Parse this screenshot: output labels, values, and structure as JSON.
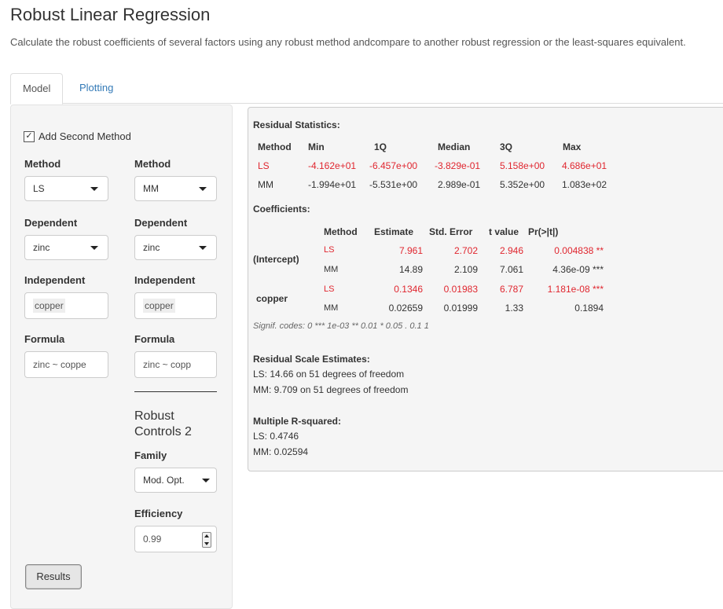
{
  "page": {
    "title": "Robust Linear Regression",
    "description": "Calculate the robust coefficients of several factors using any robust method andcompare to another robust regression or the least-squares equivalent."
  },
  "tabs": [
    {
      "label": "Model",
      "active": true
    },
    {
      "label": "Plotting",
      "active": false
    }
  ],
  "sidebar": {
    "add_second_method": {
      "label": "Add Second Method",
      "checked": true
    },
    "method_label": "Method",
    "method1": "LS",
    "method2": "MM",
    "dependent_label": "Dependent",
    "dependent1": "zinc",
    "dependent2": "zinc",
    "independent_label": "Independent",
    "independent1": "copper",
    "independent2": "copper",
    "formula_label": "Formula",
    "formula1": "zinc ~ coppe",
    "formula2": "zinc  ~ copp",
    "robust_controls_title": "Robust Controls 2",
    "family_label": "Family",
    "family_value": "Mod. Opt.",
    "efficiency_label": "Efficiency",
    "efficiency_value": "0.99",
    "results_button": "Results"
  },
  "output": {
    "residual_stats_title": "Residual Statistics:",
    "residual_headers": [
      "Method",
      "Min",
      "1Q",
      "Median",
      "3Q",
      "Max"
    ],
    "residual_rows": [
      {
        "method": "LS",
        "min": "-4.162e+01",
        "q1": "-6.457e+00",
        "median": "-3.829e-01",
        "q3": "5.158e+00",
        "max": "4.686e+01",
        "color": "#e0262f"
      },
      {
        "method": "MM",
        "min": "-1.994e+01",
        "q1": "-5.531e+00",
        "median": "2.989e-01",
        "q3": "5.352e+00",
        "max": "1.083e+02",
        "color": "#333333"
      }
    ],
    "coefficients_title": "Coefficients:",
    "coef_headers": [
      "Method",
      "Estimate",
      "Std. Error",
      "t value",
      "Pr(>|t|)"
    ],
    "coef_groups": [
      {
        "term": "(Intercept)",
        "rows": [
          {
            "method": "LS",
            "estimate": "7.961",
            "std_error": "2.702",
            "t_value": "2.946",
            "p": "0.004838 **"
          },
          {
            "method": "MM",
            "estimate": "14.89",
            "std_error": "2.109",
            "t_value": "7.061",
            "p": "4.36e-09 ***"
          }
        ]
      },
      {
        "term": "copper",
        "rows": [
          {
            "method": "LS",
            "estimate": "0.1346",
            "std_error": "0.01983",
            "t_value": "6.787",
            "p": "1.181e-08 ***"
          },
          {
            "method": "MM",
            "estimate": "0.02659",
            "std_error": "0.01999",
            "t_value": "1.33",
            "p": "0.1894"
          }
        ]
      }
    ],
    "signif_codes": "Signif. codes: 0 *** 1e-03 ** 0.01 * 0.05 . 0.1   1",
    "scale_title": "Residual Scale Estimates:",
    "scale_ls": "LS: 14.66 on 51 degrees of freedom",
    "scale_mm": "MM: 9.709 on 51 degrees of freedom",
    "rsq_title": "Multiple R-squared:",
    "rsq_ls": "LS: 0.4746",
    "rsq_mm": "MM: 0.02594"
  },
  "colors": {
    "ls": "#e0262f",
    "link": "#337ab7"
  }
}
